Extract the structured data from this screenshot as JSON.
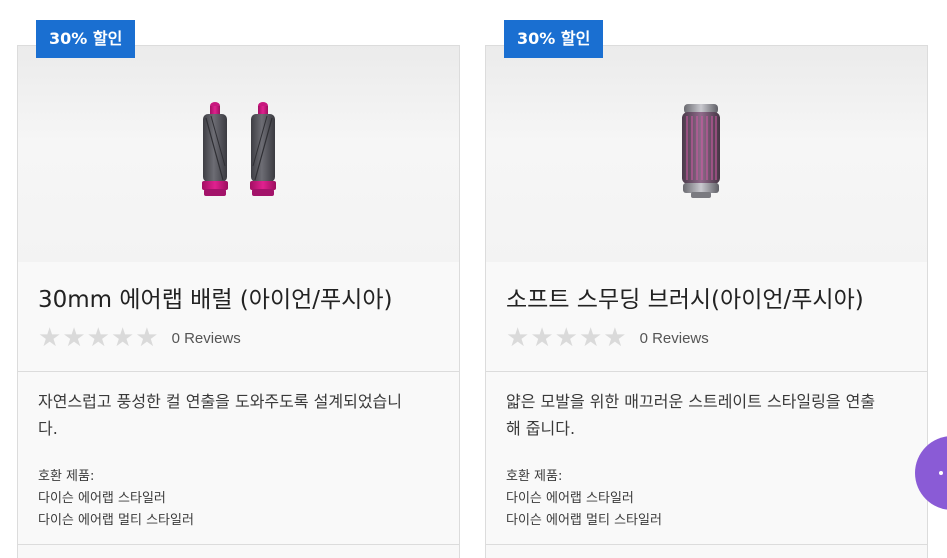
{
  "products": [
    {
      "badge": "30% 할인",
      "title": "30mm 에어랩 배럴 (아이언/푸시아)",
      "reviews": "0 Reviews",
      "rating": 0,
      "description": "자연스럽고 풍성한 컬 연출을 도와주도록 설계되었습니다.",
      "compat_label": "호환 제품:",
      "compat_items": [
        "다이슨 에어랩 스타일러",
        "다이슨 에어랩 멀티 스타일러"
      ],
      "image_icon": "curling-barrels-image"
    },
    {
      "badge": "30% 할인",
      "title": "소프트 스무딩 브러시(아이언/푸시아)",
      "reviews": "0 Reviews",
      "rating": 0,
      "description": "얇은 모발을 위한 매끄러운 스트레이트 스타일링을 연출해 줍니다.",
      "compat_label": "호환 제품:",
      "compat_items": [
        "다이슨 에어랩 스타일러",
        "다이슨 에어랩 멀티 스타일러"
      ],
      "image_icon": "smoothing-brush-image"
    }
  ],
  "colors": {
    "badge": "#1a6fd1",
    "star_empty": "#dadada",
    "chat_button": "#8a5bd6",
    "product_accent": "#d0157f",
    "product_body": "#5a5a5f"
  },
  "chat_icon": "chat-bubble-icon"
}
